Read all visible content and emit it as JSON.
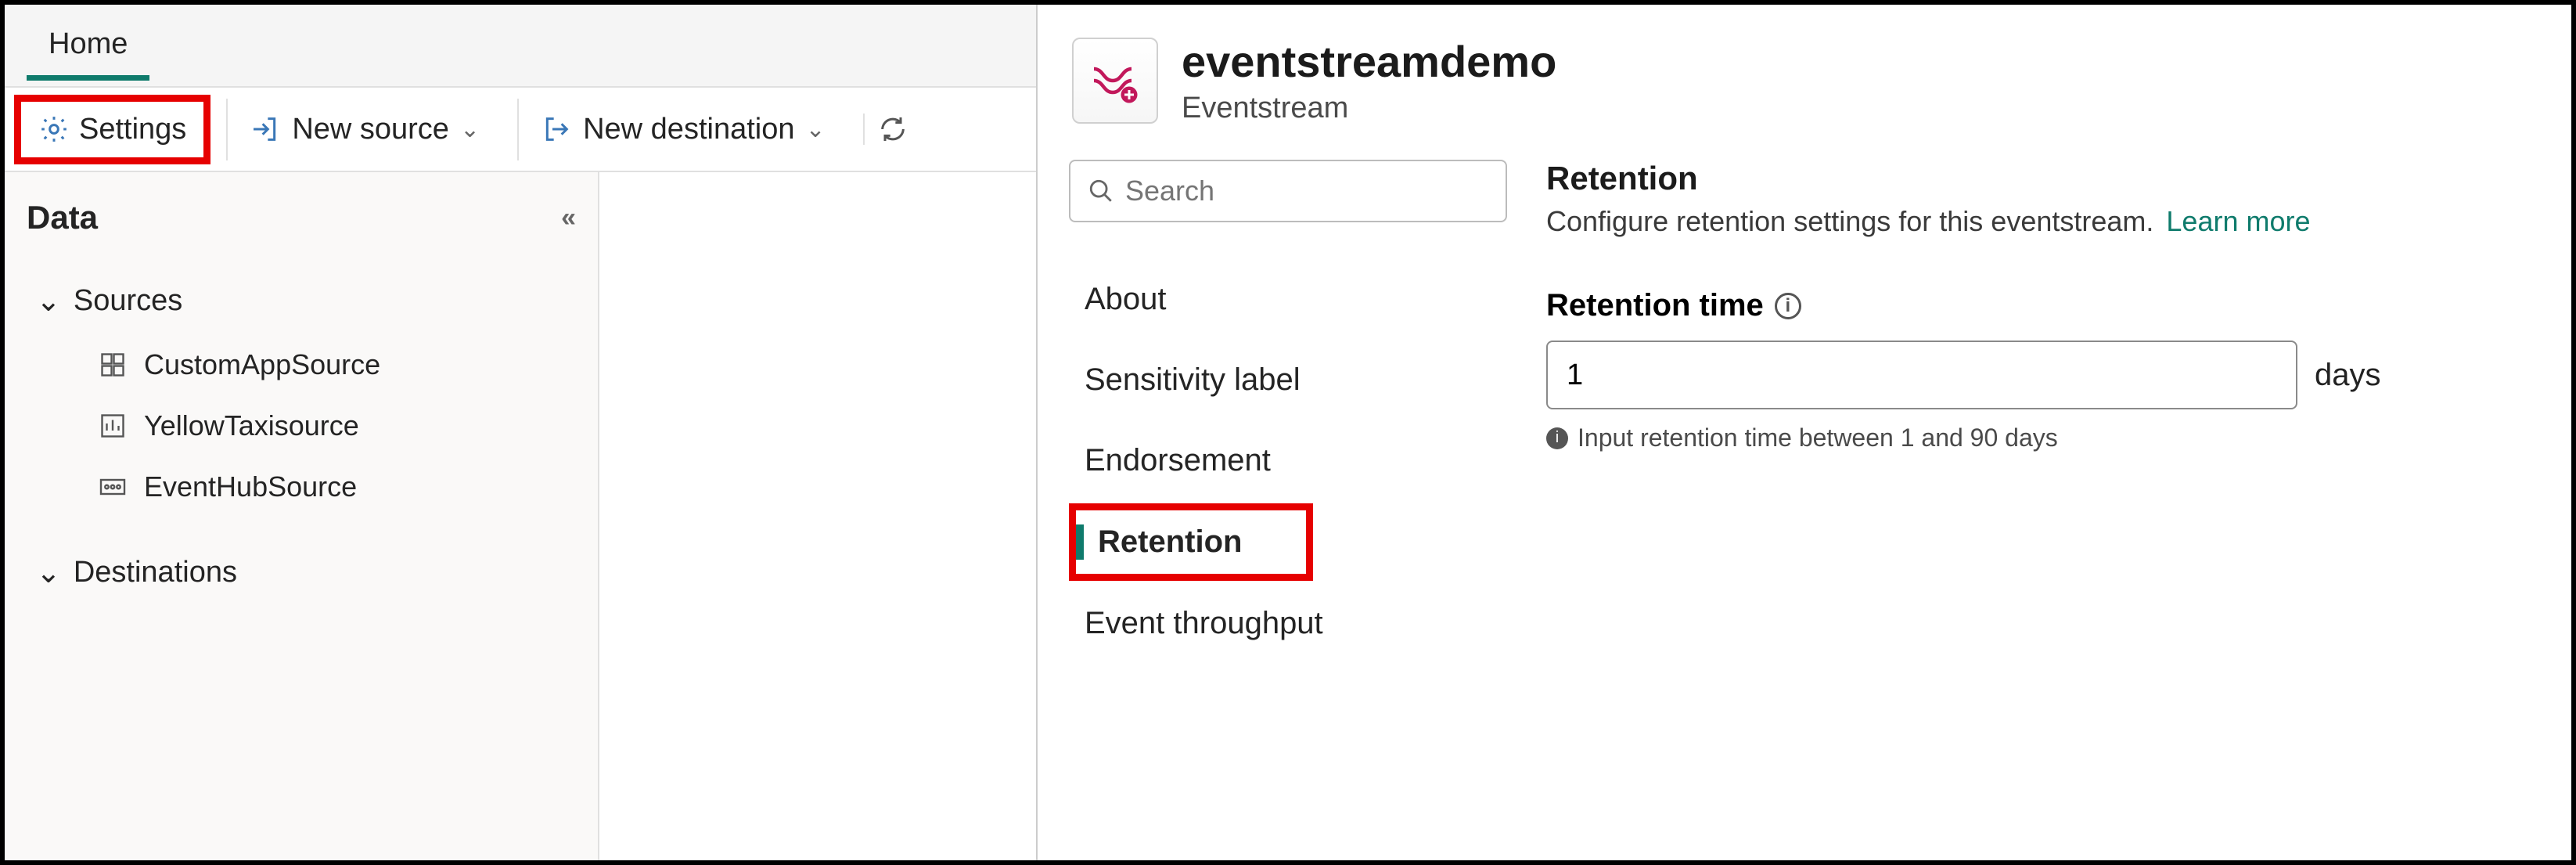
{
  "tabs": {
    "home": "Home"
  },
  "toolbar": {
    "settings": "Settings",
    "new_source": "New source",
    "new_destination": "New destination"
  },
  "data_panel": {
    "title": "Data",
    "groups": {
      "sources": "Sources",
      "destinations": "Destinations"
    },
    "sources": [
      {
        "label": "CustomAppSource"
      },
      {
        "label": "YellowTaxisource"
      },
      {
        "label": "EventHubSource"
      }
    ]
  },
  "flyout": {
    "title": "eventstreamdemo",
    "subtitle": "Eventstream",
    "search_placeholder": "Search",
    "nav": {
      "about": "About",
      "sensitivity": "Sensitivity label",
      "endorsement": "Endorsement",
      "retention": "Retention",
      "throughput": "Event throughput"
    },
    "retention": {
      "heading": "Retention",
      "desc": "Configure retention settings for this eventstream.",
      "learn_more": "Learn more",
      "field_label": "Retention time",
      "value": "1",
      "suffix": "days",
      "hint": "Input retention time between 1 and 90 days"
    }
  }
}
